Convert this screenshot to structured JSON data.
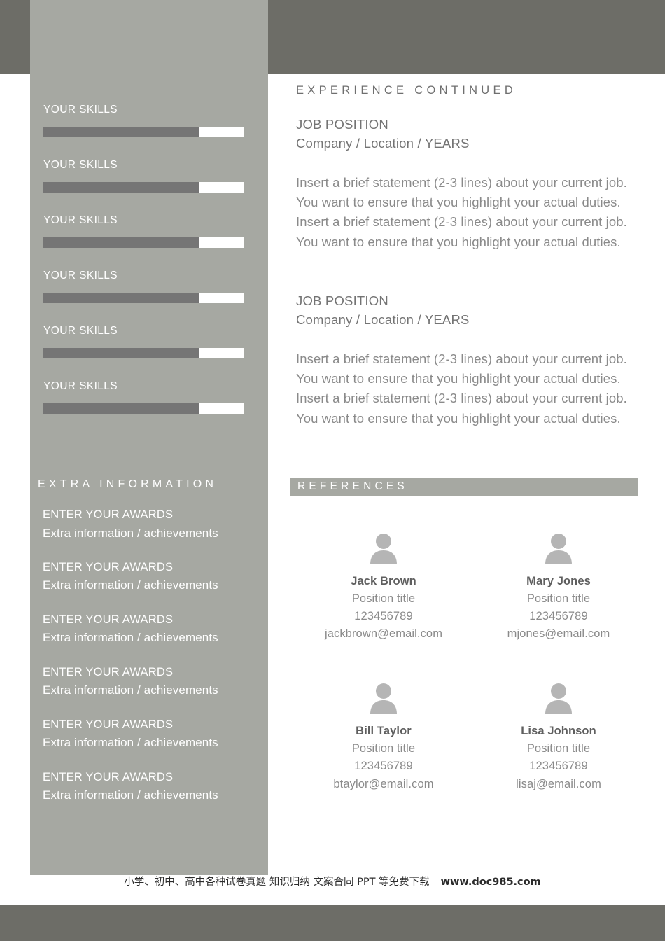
{
  "theme": {
    "band_color": "#6d6d67",
    "sidebar_color": "#a6a8a2",
    "skill_fill_color": "#757575",
    "skill_track_color": "#ffffff",
    "body_text_color": "#8a8a8a",
    "heading_text_color": "#6f6f6f",
    "avatar_color": "#b5b5b5"
  },
  "sidebar": {
    "skills": [
      {
        "label": "YOUR SKILLS",
        "percent": 78
      },
      {
        "label": "YOUR SKILLS",
        "percent": 78
      },
      {
        "label": "YOUR SKILLS",
        "percent": 78
      },
      {
        "label": "YOUR SKILLS",
        "percent": 78
      },
      {
        "label": "YOUR SKILLS",
        "percent": 78
      },
      {
        "label": "YOUR SKILLS",
        "percent": 78
      }
    ],
    "extra_information": {
      "heading": "EXTRA INFORMATION",
      "items": [
        {
          "title": "ENTER YOUR AWARDS",
          "subtitle": "Extra information / achievements"
        },
        {
          "title": "ENTER YOUR AWARDS",
          "subtitle": "Extra information / achievements"
        },
        {
          "title": "ENTER YOUR AWARDS",
          "subtitle": "Extra information / achievements"
        },
        {
          "title": "ENTER YOUR AWARDS",
          "subtitle": "Extra information / achievements"
        },
        {
          "title": "ENTER YOUR AWARDS",
          "subtitle": "Extra information / achievements"
        },
        {
          "title": "ENTER YOUR AWARDS",
          "subtitle": "Extra information / achievements"
        }
      ]
    }
  },
  "main": {
    "experience": {
      "heading": "EXPERIENCE CONTINUED",
      "jobs": [
        {
          "title": "JOB POSITION",
          "meta": "Company / Location / YEARS",
          "desc_lines": [
            "Insert a brief statement (2-3 lines) about your current job.",
            "You want to ensure that you highlight your actual duties.",
            "Insert a brief statement (2-3 lines) about your current job.",
            "You want to ensure that you highlight your actual duties."
          ]
        },
        {
          "title": "JOB POSITION",
          "meta": "Company / Location / YEARS",
          "desc_lines": [
            "Insert a brief statement (2-3 lines) about your current job.",
            "You want to ensure that you highlight your actual duties.",
            "Insert a brief statement (2-3 lines) about your current job.",
            "You want to ensure that you highlight your actual duties."
          ]
        }
      ]
    },
    "references": {
      "heading": "REFERENCES",
      "people": [
        {
          "name": "Jack Brown",
          "position": "Position title",
          "phone": "123456789",
          "email": "jackbrown@email.com",
          "avatar_icon": "person-avatar-icon"
        },
        {
          "name": "Mary Jones",
          "position": "Position title",
          "phone": "123456789",
          "email": "mjones@email.com",
          "avatar_icon": "person-avatar-icon"
        },
        {
          "name": "Bill Taylor",
          "position": "Position title",
          "phone": "123456789",
          "email": "btaylor@email.com",
          "avatar_icon": "person-avatar-icon"
        },
        {
          "name": "Lisa Johnson",
          "position": "Position title",
          "phone": "123456789",
          "email": "lisaj@email.com",
          "avatar_icon": "person-avatar-icon"
        }
      ]
    }
  },
  "footer": {
    "watermark": "小学、初中、高中各种试卷真题  知识归纳  文案合同  PPT 等免费下载",
    "url": "www.doc985.com"
  }
}
